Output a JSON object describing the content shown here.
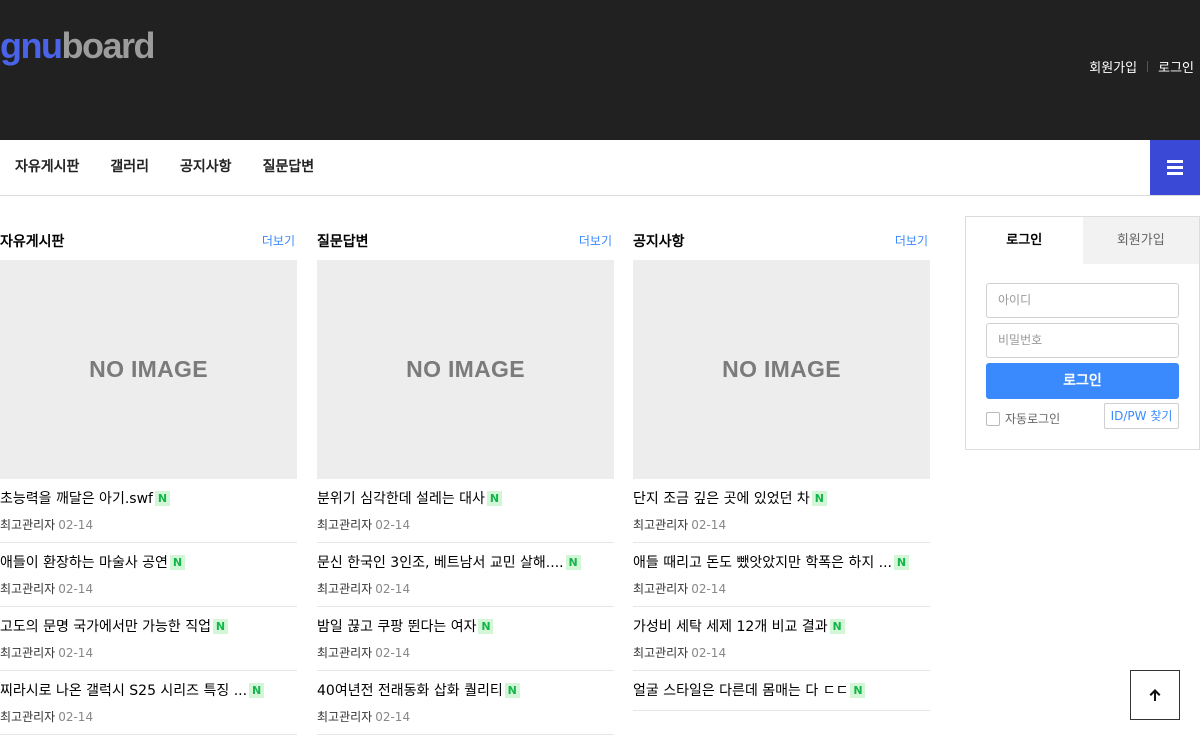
{
  "header": {
    "logo": {
      "part1": "gnu",
      "part2": "board"
    },
    "links": [
      "회원가입",
      "로그인"
    ]
  },
  "gnb": {
    "items": [
      "자유게시판",
      "갤러리",
      "공지사항",
      "질문답변"
    ]
  },
  "colors": {
    "header_bg": "#212121",
    "accent": "#3a8afd",
    "menu_btn": "#3a4ad6",
    "new_badge_bg": "#d2f6d6",
    "new_badge_fg": "#14b54b"
  },
  "columns": [
    {
      "title": "자유게시판",
      "more": "더보기",
      "image_text": "NO IMAGE",
      "posts": [
        {
          "title": "초능력을 깨달은 아기.swf",
          "badge": "N",
          "author": "최고관리자",
          "date": "02-14"
        },
        {
          "title": "애들이 환장하는 마술사 공연",
          "badge": "N",
          "author": "최고관리자",
          "date": "02-14"
        },
        {
          "title": "고도의 문명 국가에서만 가능한 직업",
          "badge": "N",
          "author": "최고관리자",
          "date": "02-14"
        },
        {
          "title": "찌라시로 나온 갤럭시 S25 시리즈 특징 ...",
          "badge": "N",
          "author": "최고관리자",
          "date": "02-14"
        }
      ]
    },
    {
      "title": "질문답변",
      "more": "더보기",
      "image_text": "NO IMAGE",
      "posts": [
        {
          "title": "분위기 심각한데 설레는 대사",
          "badge": "N",
          "author": "최고관리자",
          "date": "02-14"
        },
        {
          "title": "문신 한국인 3인조, 베트남서 교민 살해....",
          "badge": "N",
          "author": "최고관리자",
          "date": "02-14"
        },
        {
          "title": "밤일 끊고 쿠팡 뛴다는 여자",
          "badge": "N",
          "author": "최고관리자",
          "date": "02-14"
        },
        {
          "title": "40여년전 전래동화 삽화 퀄리티",
          "badge": "N",
          "author": "최고관리자",
          "date": "02-14"
        }
      ]
    },
    {
      "title": "공지사항",
      "more": "더보기",
      "image_text": "NO IMAGE",
      "posts": [
        {
          "title": "단지 조금 깊은 곳에 있었던 차",
          "badge": "N",
          "author": "최고관리자",
          "date": "02-14"
        },
        {
          "title": "애들 때리고 돈도 뺐앗았지만 학폭은 하지 ...",
          "badge": "N",
          "author": "최고관리자",
          "date": "02-14"
        },
        {
          "title": "가성비 세탁 세제 12개 비교 결과",
          "badge": "N",
          "author": "최고관리자",
          "date": "02-14"
        },
        {
          "title": "얼굴 스타일은 다른데 몸매는 다 ㄷㄷ",
          "badge": "N",
          "author": "",
          "date": ""
        }
      ]
    }
  ],
  "login": {
    "tabs": [
      "로그인",
      "회원가입"
    ],
    "id_placeholder": "아이디",
    "pw_placeholder": "비밀번호",
    "submit": "로그인",
    "auto_login": "자동로그인",
    "find": "ID/PW 찾기"
  }
}
